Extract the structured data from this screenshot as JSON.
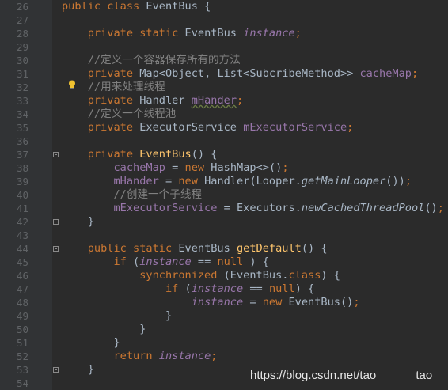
{
  "editor": {
    "lines": [
      {
        "n": "26",
        "segs": [
          [
            "kw",
            "public class "
          ],
          [
            "",
            "EventBus {"
          ]
        ]
      },
      {
        "n": "27",
        "segs": []
      },
      {
        "n": "28",
        "segs": [
          [
            "",
            "    "
          ],
          [
            "kw",
            "private static "
          ],
          [
            "",
            "EventBus "
          ],
          [
            "fieldi",
            "instance"
          ],
          [
            "kw",
            ";"
          ]
        ]
      },
      {
        "n": "29",
        "segs": []
      },
      {
        "n": "30",
        "segs": [
          [
            "",
            "    "
          ],
          [
            "comment",
            "//定义一个容器保存所有的方法"
          ]
        ]
      },
      {
        "n": "31",
        "segs": [
          [
            "",
            "    "
          ],
          [
            "kw",
            "private "
          ],
          [
            "",
            "Map<Object, List<SubcribeMethod>> "
          ],
          [
            "field",
            "cacheMap"
          ],
          [
            "kw",
            ";"
          ]
        ]
      },
      {
        "n": "32",
        "segs": [
          [
            "",
            "    "
          ],
          [
            "comment",
            "//用来处理线程"
          ]
        ]
      },
      {
        "n": "33",
        "segs": [
          [
            "",
            "    "
          ],
          [
            "kw",
            "private "
          ],
          [
            "",
            "Handler "
          ],
          [
            "field typo",
            "mHander"
          ],
          [
            "kw",
            ";"
          ]
        ]
      },
      {
        "n": "34",
        "segs": [
          [
            "",
            "    "
          ],
          [
            "comment",
            "//定义一个线程池"
          ]
        ]
      },
      {
        "n": "35",
        "segs": [
          [
            "",
            "    "
          ],
          [
            "kw",
            "private "
          ],
          [
            "",
            "ExecutorService "
          ],
          [
            "field",
            "mExecutorService"
          ],
          [
            "kw",
            ";"
          ]
        ]
      },
      {
        "n": "36",
        "segs": []
      },
      {
        "n": "37",
        "segs": [
          [
            "",
            "    "
          ],
          [
            "kw",
            "private "
          ],
          [
            "method",
            "EventBus"
          ],
          [
            "",
            "() {"
          ]
        ]
      },
      {
        "n": "38",
        "segs": [
          [
            "",
            "        "
          ],
          [
            "field",
            "cacheMap"
          ],
          [
            "",
            " = "
          ],
          [
            "kw",
            "new "
          ],
          [
            "",
            "HashMap<>()"
          ],
          [
            "kw",
            ";"
          ]
        ]
      },
      {
        "n": "39",
        "segs": [
          [
            "",
            "        "
          ],
          [
            "field",
            "mHander"
          ],
          [
            "",
            " = "
          ],
          [
            "kw",
            "new "
          ],
          [
            "",
            "Handler(Looper."
          ],
          [
            "statici",
            "getMainLooper"
          ],
          [
            "",
            "())"
          ],
          [
            "kw",
            ";"
          ]
        ]
      },
      {
        "n": "40",
        "segs": [
          [
            "",
            "        "
          ],
          [
            "comment",
            "//创建一个子线程"
          ]
        ]
      },
      {
        "n": "41",
        "segs": [
          [
            "",
            "        "
          ],
          [
            "field",
            "mExecutorService"
          ],
          [
            "",
            " = Executors."
          ],
          [
            "statici",
            "newCachedThreadPool"
          ],
          [
            "",
            "()"
          ],
          [
            "kw",
            ";"
          ]
        ]
      },
      {
        "n": "42",
        "segs": [
          [
            "",
            "    }"
          ]
        ]
      },
      {
        "n": "43",
        "segs": []
      },
      {
        "n": "44",
        "segs": [
          [
            "",
            "    "
          ],
          [
            "kw",
            "public static "
          ],
          [
            "",
            "EventBus "
          ],
          [
            "method",
            "getDefault"
          ],
          [
            "",
            "() {"
          ]
        ]
      },
      {
        "n": "45",
        "segs": [
          [
            "",
            "        "
          ],
          [
            "kw",
            "if "
          ],
          [
            "",
            "("
          ],
          [
            "fieldi",
            "instance"
          ],
          [
            "",
            " == "
          ],
          [
            "kw",
            "null"
          ],
          [
            "",
            " ) {"
          ]
        ]
      },
      {
        "n": "46",
        "segs": [
          [
            "",
            "            "
          ],
          [
            "kw",
            "synchronized "
          ],
          [
            "",
            "(EventBus."
          ],
          [
            "kw",
            "class"
          ],
          [
            "",
            ") {"
          ]
        ]
      },
      {
        "n": "47",
        "segs": [
          [
            "",
            "                "
          ],
          [
            "kw",
            "if "
          ],
          [
            "",
            "("
          ],
          [
            "fieldi",
            "instance"
          ],
          [
            "",
            " == "
          ],
          [
            "kw",
            "null"
          ],
          [
            "",
            ") {"
          ]
        ]
      },
      {
        "n": "48",
        "segs": [
          [
            "",
            "                    "
          ],
          [
            "fieldi",
            "instance"
          ],
          [
            "",
            " = "
          ],
          [
            "kw",
            "new "
          ],
          [
            "",
            "EventBus()"
          ],
          [
            "kw",
            ";"
          ]
        ]
      },
      {
        "n": "49",
        "segs": [
          [
            "",
            "                }"
          ]
        ]
      },
      {
        "n": "50",
        "segs": [
          [
            "",
            "            }"
          ]
        ]
      },
      {
        "n": "51",
        "segs": [
          [
            "",
            "        }"
          ]
        ]
      },
      {
        "n": "52",
        "segs": [
          [
            "",
            "        "
          ],
          [
            "kw",
            "return "
          ],
          [
            "fieldi",
            "instance"
          ],
          [
            "kw",
            ";"
          ]
        ]
      },
      {
        "n": "53",
        "segs": [
          [
            "",
            "    }"
          ]
        ]
      },
      {
        "n": "54",
        "segs": []
      }
    ],
    "fold_marker_lines": [
      "37",
      "42",
      "44",
      "53"
    ]
  },
  "watermark": "https://blog.csdn.net/tao______tao",
  "colors": {
    "background": "#2b2b2b",
    "gutter": "#313335",
    "keyword": "#cc7832",
    "field": "#9876aa",
    "method": "#ffc66d",
    "comment": "#808080",
    "text": "#a9b7c6",
    "line_number": "#606366"
  },
  "icons": {
    "intention": "lightbulb-icon",
    "fold": "fold-marker-icon"
  }
}
